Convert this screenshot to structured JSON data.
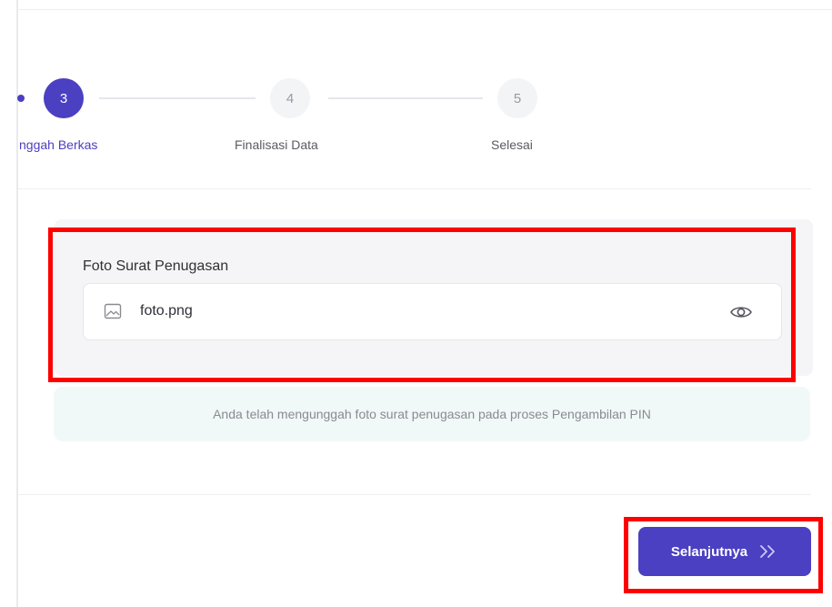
{
  "stepper": {
    "steps": [
      {
        "number": "3",
        "label": "nggah Berkas",
        "state": "active"
      },
      {
        "number": "4",
        "label": "Finalisasi Data",
        "state": "inactive"
      },
      {
        "number": "5",
        "label": "Selesai",
        "state": "inactive"
      }
    ]
  },
  "upload": {
    "field_label": "Foto Surat Penugasan",
    "file_name": "foto.png",
    "file_icon": "image-file-icon",
    "preview_icon": "eye-icon"
  },
  "info_banner": {
    "text": "Anda telah mengunggah foto surat penugasan pada proses Pengambilan PIN"
  },
  "actions": {
    "next_label": "Selanjutnya",
    "next_icon": "double-chevron-right-icon"
  },
  "colors": {
    "primary": "#4b3fc2",
    "highlight": "#ff0000",
    "card_bg": "#f5f5f7",
    "banner_bg": "#f1f8f8"
  }
}
